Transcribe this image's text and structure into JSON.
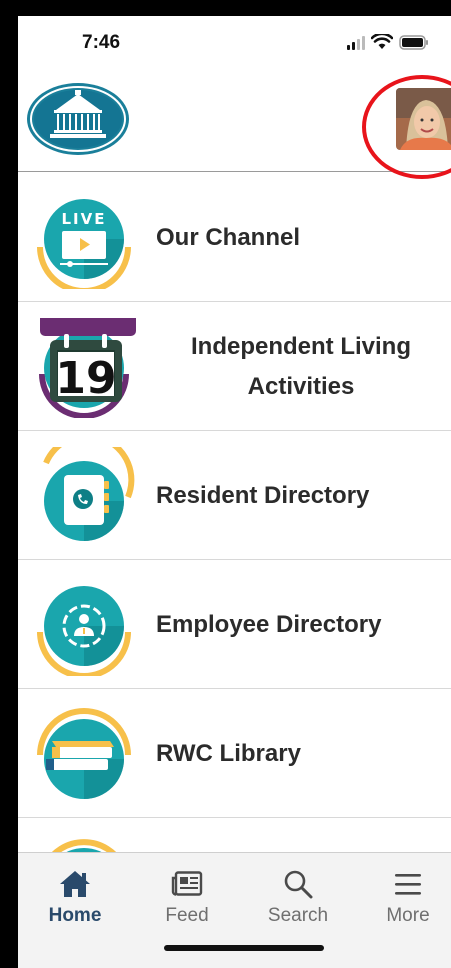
{
  "status_bar": {
    "time": "7:46"
  },
  "header": {
    "logo": "gazebo-logo",
    "avatar": "user-avatar"
  },
  "menu": [
    {
      "label": "Our Channel",
      "icon": "live-video-icon",
      "badge": "LIVE"
    },
    {
      "label": "Independent Living Activities",
      "icon": "calendar-icon",
      "day": "19"
    },
    {
      "label": "Resident Directory",
      "icon": "phone-book-icon"
    },
    {
      "label": "Employee Directory",
      "icon": "employee-badge-icon"
    },
    {
      "label": "RWC Library",
      "icon": "books-icon"
    }
  ],
  "tabs": [
    {
      "label": "Home",
      "icon": "home-icon",
      "active": true
    },
    {
      "label": "Feed",
      "icon": "newspaper-icon"
    },
    {
      "label": "Search",
      "icon": "search-icon"
    },
    {
      "label": "More",
      "icon": "menu-icon"
    }
  ],
  "colors": {
    "teal": "#1aa6ad",
    "teal_dark": "#0e7f86",
    "gold": "#f7c04a",
    "purple": "#6b2d72",
    "active_tab": "#2a4a6b",
    "highlight": "#e8141b"
  }
}
